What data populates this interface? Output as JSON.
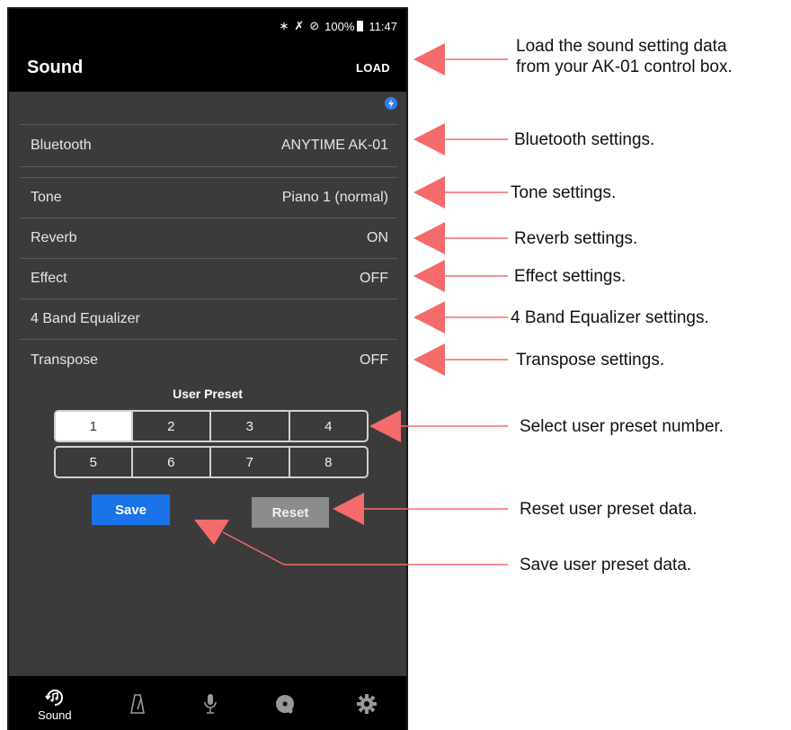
{
  "status_bar": {
    "icons": [
      "bluetooth-icon",
      "mute-icon",
      "no-disturb-icon"
    ],
    "battery": "100%",
    "time": "11:47"
  },
  "app_bar": {
    "title": "Sound",
    "load_label": "LOAD"
  },
  "settings": [
    {
      "label": "Bluetooth",
      "value": "ANYTIME AK-01"
    },
    {
      "label": "Tone",
      "value": "Piano 1 (normal)"
    },
    {
      "label": "Reverb",
      "value": "ON"
    },
    {
      "label": "Effect",
      "value": "OFF"
    },
    {
      "label": "4 Band Equalizer",
      "value": ""
    },
    {
      "label": "Transpose",
      "value": "OFF"
    }
  ],
  "user_preset": {
    "title": "User Preset",
    "numbers": [
      "1",
      "2",
      "3",
      "4",
      "5",
      "6",
      "7",
      "8"
    ],
    "selected": "1",
    "save_label": "Save",
    "reset_label": "Reset"
  },
  "bottom_nav": [
    {
      "icon": "sound-icon",
      "label": "Sound",
      "active": true
    },
    {
      "icon": "metronome-icon",
      "label": ""
    },
    {
      "icon": "microphone-icon",
      "label": ""
    },
    {
      "icon": "music-disc-icon",
      "label": ""
    },
    {
      "icon": "gear-icon",
      "label": ""
    }
  ],
  "annotations": {
    "load": [
      "Load the sound setting data",
      "from your AK-01 control box."
    ],
    "bluetooth": "Bluetooth settings.",
    "tone": "Tone settings.",
    "reverb": "Reverb settings.",
    "effect": "Effect settings.",
    "equalizer": "4 Band Equalizer settings.",
    "transpose": "Transpose settings.",
    "select_preset": "Select user preset number.",
    "reset_preset": "Reset user preset data.",
    "save_preset": "Save user preset data."
  },
  "colors": {
    "accent": "#1a73e8",
    "arrow": "#f36b6b",
    "panel": "#3b3b3b",
    "bar": "#000000"
  }
}
